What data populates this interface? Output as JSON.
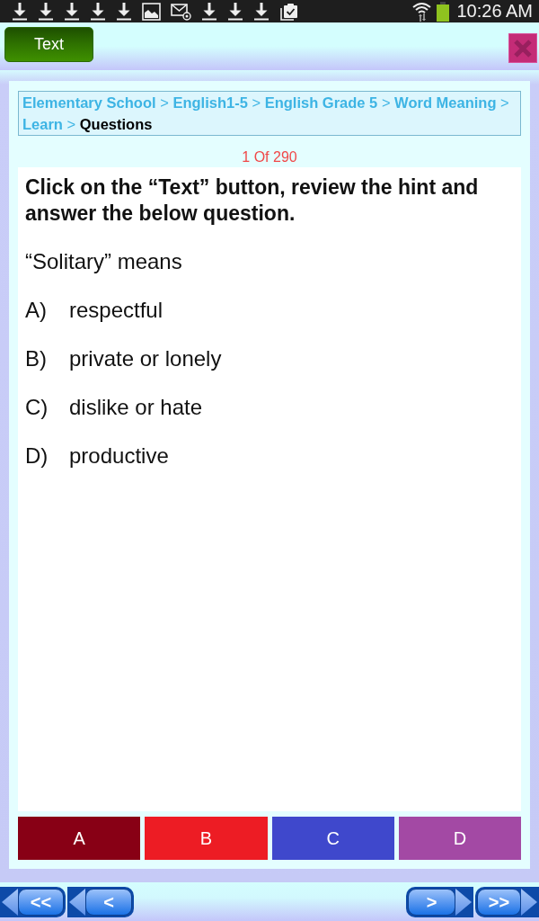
{
  "status_bar": {
    "time": "10:26 AM"
  },
  "top_bar": {
    "text_button": "Text"
  },
  "breadcrumb": {
    "items": [
      {
        "label": "Elementary School",
        "current": false,
        "separator": ">"
      },
      {
        "label": "English1-5",
        "current": false,
        "separator": ">"
      },
      {
        "label": "English Grade 5",
        "current": false,
        "separator": ">"
      },
      {
        "label": "Word Meaning",
        "current": false,
        "separator": ">"
      },
      {
        "label": "Learn",
        "current": false,
        "separator": ">"
      },
      {
        "label": "Questions",
        "current": true
      }
    ]
  },
  "counter": "1 Of 290",
  "question": {
    "instruction": "Click on the “Text” button, review the hint and answer the below question.",
    "prompt": "“Solitary” means",
    "options": [
      {
        "letter": "A)",
        "text": "respectful"
      },
      {
        "letter": "B)",
        "text": "private or lonely"
      },
      {
        "letter": "C)",
        "text": "dislike or hate"
      },
      {
        "letter": "D)",
        "text": "productive"
      }
    ]
  },
  "answer_buttons": [
    {
      "label": "A",
      "color": "#880015"
    },
    {
      "label": "B",
      "color": "#ed1c24"
    },
    {
      "label": "C",
      "color": "#3f48cc"
    },
    {
      "label": "D",
      "color": "#a349a4"
    }
  ],
  "pager": [
    {
      "label": "<<",
      "kind": "first"
    },
    {
      "label": "<",
      "kind": "previous"
    },
    {
      "label": ">",
      "kind": "next"
    },
    {
      "label": ">>",
      "kind": "last"
    }
  ]
}
